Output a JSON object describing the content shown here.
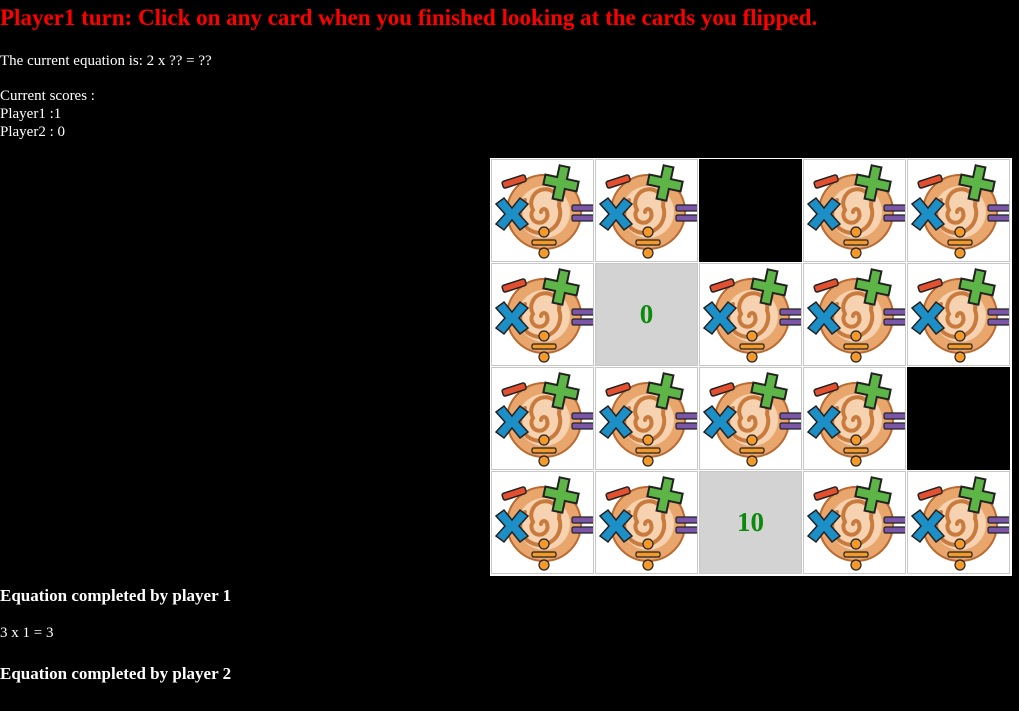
{
  "turn_message": "Player1 turn: Click on any card when you finished looking at the cards you flipped.",
  "equation": {
    "label": "The current equation is: 2 x ?? = ??"
  },
  "scores": {
    "title": "Current scores :",
    "player1": "Player1 :1",
    "player2": "Player2 : 0"
  },
  "board": {
    "rows": 4,
    "cols": 5,
    "cards": [
      {
        "state": "back"
      },
      {
        "state": "back"
      },
      {
        "state": "removed"
      },
      {
        "state": "back"
      },
      {
        "state": "back"
      },
      {
        "state": "back"
      },
      {
        "state": "face",
        "value": "0"
      },
      {
        "state": "back"
      },
      {
        "state": "back"
      },
      {
        "state": "back"
      },
      {
        "state": "back"
      },
      {
        "state": "back"
      },
      {
        "state": "back"
      },
      {
        "state": "back"
      },
      {
        "state": "removed"
      },
      {
        "state": "back"
      },
      {
        "state": "back"
      },
      {
        "state": "face",
        "value": "10"
      },
      {
        "state": "back"
      },
      {
        "state": "back"
      }
    ],
    "face_color": "#d3d3d3",
    "value_color": "#0b8a0b"
  },
  "completed": {
    "player1_heading": "Equation completed by player 1",
    "player1_equations": [
      "3 x 1 = 3"
    ],
    "player2_heading": "Equation completed by player 2",
    "player2_equations": []
  },
  "icons": {
    "card_back": "math-spiral-card-back-icon"
  }
}
